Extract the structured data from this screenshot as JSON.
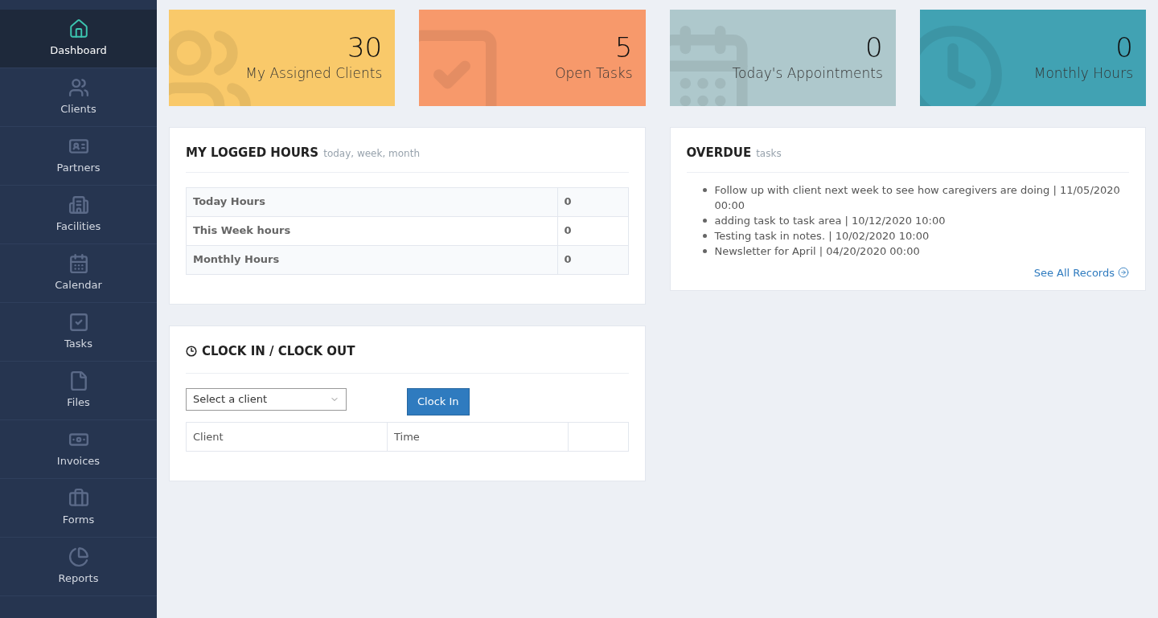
{
  "sidebar": {
    "items": [
      {
        "label": "Dashboard",
        "kind": "home",
        "selected": true
      },
      {
        "label": "Clients",
        "kind": "users",
        "selected": false
      },
      {
        "label": "Partners",
        "kind": "idcard",
        "selected": false
      },
      {
        "label": "Facilities",
        "kind": "building",
        "selected": false
      },
      {
        "label": "Calendar",
        "kind": "calendar",
        "selected": false
      },
      {
        "label": "Tasks",
        "kind": "check",
        "selected": false
      },
      {
        "label": "Files",
        "kind": "file",
        "selected": false
      },
      {
        "label": "Invoices",
        "kind": "money",
        "selected": false
      },
      {
        "label": "Forms",
        "kind": "briefcase",
        "selected": false
      },
      {
        "label": "Reports",
        "kind": "pie",
        "selected": false
      }
    ]
  },
  "stats": [
    {
      "value": "30",
      "label": "My Assigned Clients",
      "kind": "users",
      "color": "#f9c96a"
    },
    {
      "value": "5",
      "label": "Open Tasks",
      "kind": "check",
      "color": "#f7996b"
    },
    {
      "value": "0",
      "label": "Today's Appointments",
      "kind": "calendar",
      "color": "#aec8cc"
    },
    {
      "value": "0",
      "label": "Monthly Hours",
      "kind": "clock",
      "color": "#41a2b3"
    }
  ],
  "logged_hours": {
    "title": "MY LOGGED HOURS",
    "subtitle": "today, week, month",
    "rows": [
      {
        "label": "Today Hours",
        "value": "0"
      },
      {
        "label": "This Week hours",
        "value": "0"
      },
      {
        "label": "Monthly Hours",
        "value": "0"
      }
    ]
  },
  "clock": {
    "title": "CLOCK IN / CLOCK OUT",
    "select_placeholder": "Select a client",
    "button": "Clock In",
    "columns": [
      "Client",
      "Time"
    ]
  },
  "overdue": {
    "title": "OVERDUE",
    "subtitle": "tasks",
    "items": [
      "Follow up with client next week to see how caregivers are doing | 11/05/2020 00:00",
      "adding task to task area | 10/12/2020 10:00",
      "Testing task in notes. | 10/02/2020 10:00",
      "Newsletter for April | 04/20/2020 00:00"
    ],
    "link": "See All Records"
  }
}
